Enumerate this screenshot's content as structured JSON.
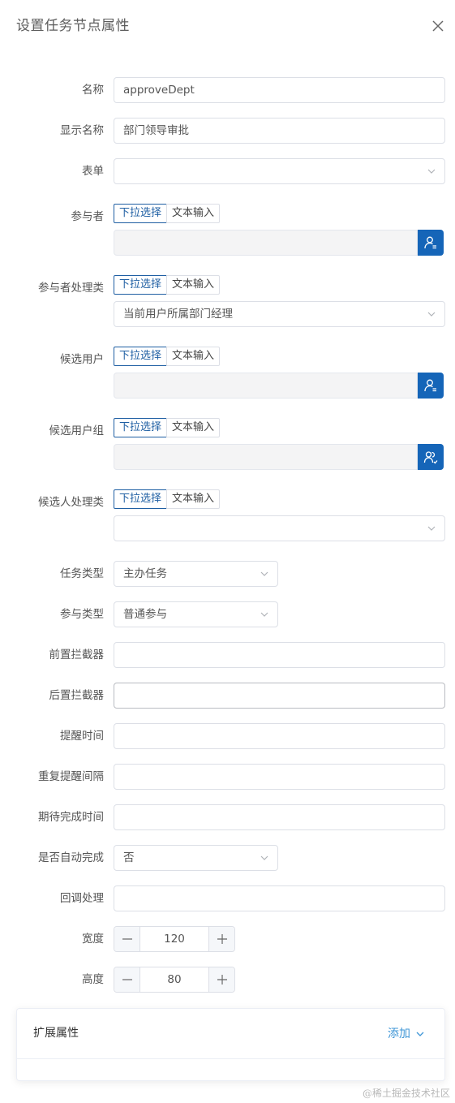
{
  "dialog": {
    "title": "设置任务节点属性"
  },
  "seg": {
    "dropdown": "下拉选择",
    "text": "文本输入"
  },
  "form": {
    "name": {
      "label": "名称",
      "value": "approveDept"
    },
    "display_name": {
      "label": "显示名称",
      "value": "部门领导审批"
    },
    "form": {
      "label": "表单",
      "value": ""
    },
    "assignee": {
      "label": "参与者",
      "value": ""
    },
    "assignee_handler": {
      "label": "参与者处理类",
      "value": "当前用户所属部门经理"
    },
    "candidate_users": {
      "label": "候选用户",
      "value": ""
    },
    "candidate_groups": {
      "label": "候选用户组",
      "value": ""
    },
    "candidate_handler": {
      "label": "候选人处理类",
      "value": ""
    },
    "task_type": {
      "label": "任务类型",
      "value": "主办任务"
    },
    "participation_type": {
      "label": "参与类型",
      "value": "普通参与"
    },
    "pre_interceptor": {
      "label": "前置拦截器",
      "value": ""
    },
    "post_interceptor": {
      "label": "后置拦截器",
      "value": ""
    },
    "reminder_time": {
      "label": "提醒时间",
      "value": ""
    },
    "repeat_interval": {
      "label": "重复提醒间隔",
      "value": ""
    },
    "expected_time": {
      "label": "期待完成时间",
      "value": ""
    },
    "auto_complete": {
      "label": "是否自动完成",
      "value": "否"
    },
    "callback": {
      "label": "回调处理",
      "value": ""
    },
    "width": {
      "label": "宽度",
      "value": "120"
    },
    "height": {
      "label": "高度",
      "value": "80"
    }
  },
  "ext": {
    "title": "扩展属性",
    "add_label": "添加"
  },
  "watermark": "@稀土掘金技术社区",
  "colors": {
    "primary": "#1565b8",
    "link": "#3d95d6",
    "border": "#dcdfe6"
  },
  "icons": {
    "close": "close-icon",
    "chevron": "chevron-down-icon",
    "user_select": "user-select-icon",
    "group_select": "group-select-icon"
  }
}
